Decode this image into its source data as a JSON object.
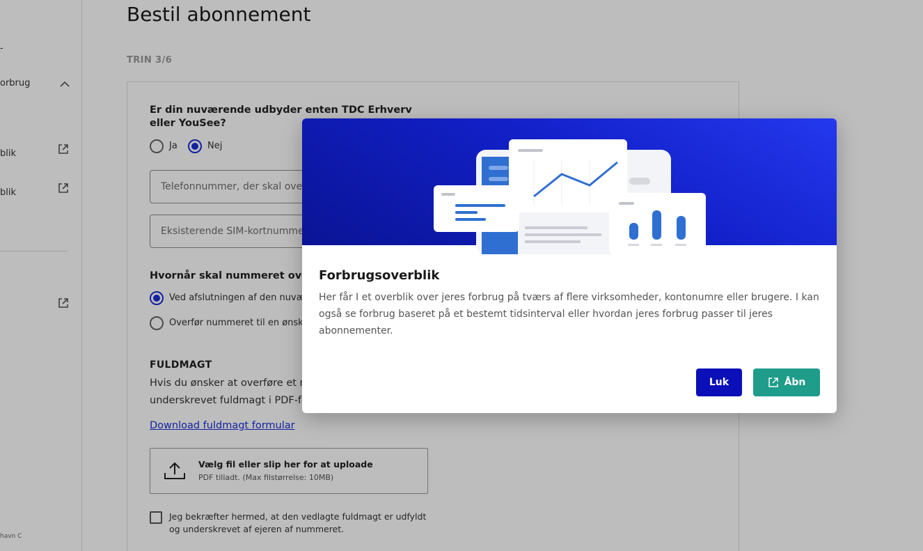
{
  "sidebar": {
    "items": [
      {
        "label": "orbrug"
      },
      {
        "label": "blik"
      },
      {
        "label": "blik"
      }
    ],
    "footer": "havn C"
  },
  "main": {
    "title": "Bestil abonnement",
    "step": "TRIN 3/6",
    "provider_question": "Er din nuværende udbyder enten TDC Erhverv eller YouSee?",
    "provider_options": [
      "Ja",
      "Nej"
    ],
    "phone_placeholder": "Telefonnummer, der skal overføres",
    "sim_placeholder": "Eksisterende SIM-kortnummer",
    "transfer_question": "Hvornår skal nummeret overføres?",
    "transfer_options": [
      "Ved afslutningen af den nuværende",
      "Overfør nummeret til en ønsket dato"
    ],
    "authorization_title": "FULDMAGT",
    "authorization_text": "Hvis du ønsker at overføre et nummer\nunderskrevet fuldmagt i PDF-format",
    "download_link": "Download fuldmagt formular",
    "upload_title": "Vælg fil eller slip her for at uploade",
    "upload_hint": "PDF tilladt. (Max filstørrelse: 10MB)",
    "confirm_label": "Jeg bekræfter hermed, at den vedlagte fuldmagt er udfyldt og underskrevet af ejeren af nummeret."
  },
  "modal": {
    "title": "Forbrugsoverblik",
    "description": "Her får I et overblik over jeres forbrug på tværs af flere virksomheder, kontonumre eller brugere. I kan også se forbrug baseret på et bestemt tidsinterval eller hvordan jeres forbrug passer til jeres abonnementer.",
    "close_label": "Luk",
    "open_label": "Åbn",
    "accent_color": "#0a0fb8",
    "open_color": "#1f9c8a",
    "hero_color": "#1220c8"
  }
}
